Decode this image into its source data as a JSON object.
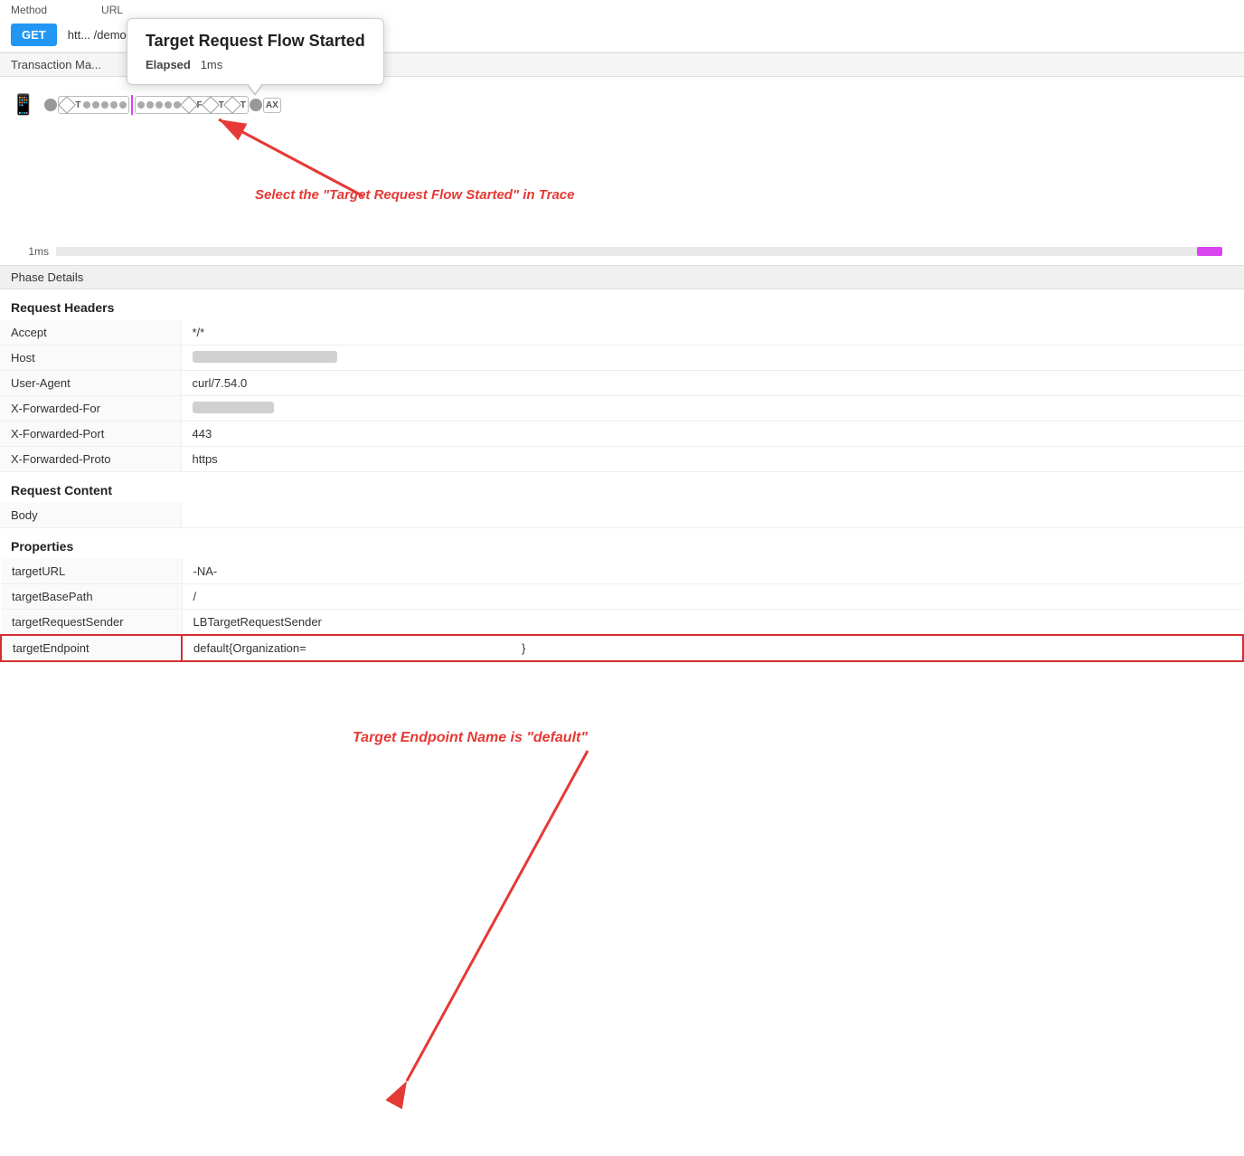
{
  "header": {
    "method_label": "Method",
    "url_label": "URL",
    "method": "GET",
    "url": "htt... /demo-noactivetargets"
  },
  "tooltip": {
    "title": "Target Request Flow Started",
    "elapsed_label": "Elapsed",
    "elapsed_value": "1ms"
  },
  "transaction_map": {
    "label": "Transaction Ma...",
    "trace_nodes": [
      "T",
      "F",
      "T",
      "T",
      "AX"
    ],
    "timeline_label": "1ms"
  },
  "annotation_trace": "Select the \"Target Request Flow Started\" in Trace",
  "phase_details": {
    "label": "Phase Details"
  },
  "request_headers": {
    "title": "Request Headers",
    "rows": [
      {
        "key": "Accept",
        "value": "*/*",
        "blurred": false
      },
      {
        "key": "Host",
        "value": "",
        "blurred": true
      },
      {
        "key": "User-Agent",
        "value": "curl/7.54.0",
        "blurred": false
      },
      {
        "key": "X-Forwarded-For",
        "value": "",
        "blurred": true
      },
      {
        "key": "X-Forwarded-Port",
        "value": "443",
        "blurred": false
      },
      {
        "key": "X-Forwarded-Proto",
        "value": "https",
        "blurred": false
      }
    ]
  },
  "request_content": {
    "title": "Request Content",
    "rows": [
      {
        "key": "Body",
        "value": "",
        "blurred": false
      }
    ],
    "annotation": "Target Endpoint Name is \"default\""
  },
  "properties": {
    "title": "Properties",
    "rows": [
      {
        "key": "targetURL",
        "value": "-NA-",
        "blurred": false,
        "highlighted": false
      },
      {
        "key": "targetBasePath",
        "value": "/",
        "blurred": false,
        "highlighted": false
      },
      {
        "key": "targetRequestSender",
        "value": "LBTargetRequestSender",
        "blurred": false,
        "highlighted": false
      },
      {
        "key": "targetEndpoint",
        "value": "default{Organization=",
        "blurred": false,
        "highlighted": true,
        "suffix": "}"
      }
    ]
  }
}
